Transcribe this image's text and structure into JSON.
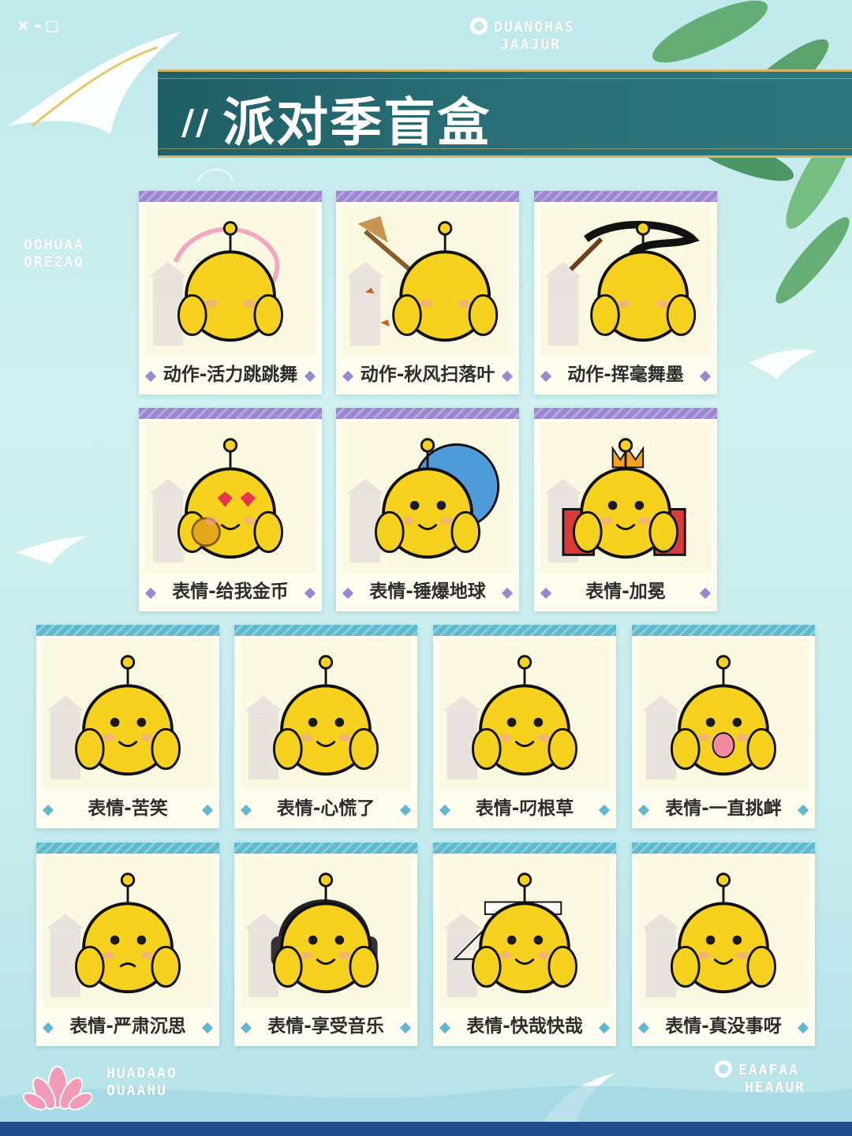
{
  "title": "派对季盲盒",
  "title_prefix": "//",
  "top_mark": "×-□",
  "logos": {
    "top_right_line1": "DUANOHAS",
    "top_right_line2": "JAAJUR",
    "left_line1": "OOHUAA",
    "left_line2": "OREZAO",
    "bottom_left_line1": "HUADAAO",
    "bottom_left_line2": "OUAAHU",
    "bottom_right_line1": "EAAFAA",
    "bottom_right_line2": "HEAAUR"
  },
  "colors": {
    "banner": "#2a7078",
    "mascot": "#f6d21f",
    "purple_band": "#9b86cf",
    "teal_band": "#5fb8cc"
  },
  "cards": [
    {
      "caption": "动作-活力跳跳舞",
      "style": "purple",
      "icon": "ribbon-dance-mascot-icon"
    },
    {
      "caption": "动作-秋风扫落叶",
      "style": "purple",
      "icon": "broom-leaves-mascot-icon"
    },
    {
      "caption": "动作-挥毫舞墨",
      "style": "purple",
      "icon": "brush-ink-mascot-icon"
    },
    {
      "caption": "表情-给我金币",
      "style": "purple",
      "icon": "heart-eyes-coin-mascot-icon"
    },
    {
      "caption": "表情-锤爆地球",
      "style": "purple",
      "icon": "smash-earth-mascot-icon"
    },
    {
      "caption": "表情-加冕",
      "style": "purple",
      "icon": "crown-mascot-icon"
    },
    {
      "caption": "表情-苦笑",
      "style": "teal",
      "icon": "crying-laugh-mascot-icon"
    },
    {
      "caption": "表情-心慌了",
      "style": "teal",
      "icon": "nervous-mascot-icon"
    },
    {
      "caption": "表情-叼根草",
      "style": "teal",
      "icon": "grass-mascot-icon"
    },
    {
      "caption": "表情-一直挑衅",
      "style": "teal",
      "icon": "tongue-out-mascot-icon"
    },
    {
      "caption": "表情-严肃沉思",
      "style": "teal",
      "icon": "serious-mascot-icon"
    },
    {
      "caption": "表情-享受音乐",
      "style": "teal",
      "icon": "headphones-mascot-icon"
    },
    {
      "caption": "表情-快哉快哉",
      "style": "teal",
      "icon": "fan-headband-mascot-icon"
    },
    {
      "caption": "表情-真没事呀",
      "style": "teal",
      "icon": "bruised-smile-mascot-icon"
    }
  ]
}
